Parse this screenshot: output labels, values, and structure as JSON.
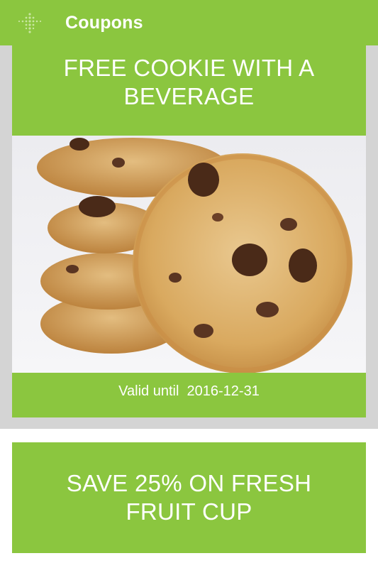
{
  "appbar": {
    "title": "Coupons",
    "menu_icon": "dots-grid-icon",
    "color": "#8bc63f"
  },
  "coupons": [
    {
      "title": "FREE COOKIE WITH A BEVERAGE",
      "valid_label": "Valid until",
      "valid_date": "2016-12-31",
      "image": "chocolate-chip-cookies"
    },
    {
      "title": "SAVE 25% ON FRESH FRUIT CUP"
    }
  ]
}
